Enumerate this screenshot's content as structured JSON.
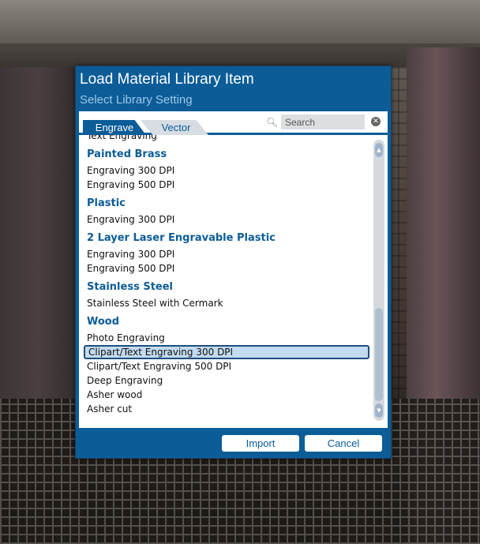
{
  "dialog": {
    "title": "Load Material Library Item",
    "subtitle": "Select Library Setting"
  },
  "tabs": [
    {
      "label": "Engrave",
      "active": true
    },
    {
      "label": "Vector",
      "active": false
    }
  ],
  "search": {
    "placeholder": "Search"
  },
  "list": {
    "partial_top_item": "Text Engraving",
    "groups": [
      {
        "name": "Painted Brass",
        "items": [
          "Engraving 300 DPI",
          "Engraving 500 DPI"
        ]
      },
      {
        "name": "Plastic",
        "items": [
          "Engraving 300 DPI"
        ]
      },
      {
        "name": "2 Layer Laser Engravable Plastic",
        "items": [
          "Engraving 300 DPI",
          "Engraving 500 DPI"
        ]
      },
      {
        "name": "Stainless Steel",
        "items": [
          "Stainless Steel with Cermark"
        ]
      },
      {
        "name": "Wood",
        "items": [
          "Photo Engraving",
          "Clipart/Text Engraving 300 DPI",
          "Clipart/Text Engraving 500 DPI",
          "Deep Engraving",
          "Asher wood",
          "Asher cut"
        ]
      }
    ],
    "selected_item": "Clipart/Text Engraving 300 DPI"
  },
  "buttons": {
    "import_label": "Import",
    "cancel_label": "Cancel"
  },
  "colors": {
    "dialog_blue": "#0b5c97",
    "selection": "#c3dbef"
  },
  "icons": {
    "search": "search-icon",
    "clear": "clear-icon",
    "scroll_up": "chevron-up-icon",
    "scroll_down": "chevron-down-icon"
  }
}
